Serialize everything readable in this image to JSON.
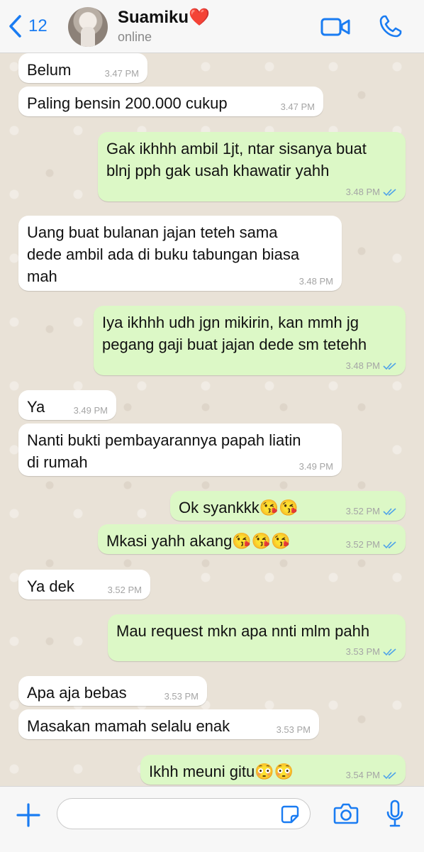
{
  "header": {
    "back_count": "12",
    "contact_name": "Suamiku❤️",
    "status": "online"
  },
  "messages": [
    {
      "dir": "in",
      "text": "Belum",
      "time": "3.47 PM"
    },
    {
      "dir": "in",
      "text": "Paling bensin 200.000 cukup",
      "time": "3.47 PM"
    },
    {
      "dir": "out",
      "text": "Gak ikhhh ambil 1jt, ntar sisanya buat\nblnj pph gak usah khawatir yahh",
      "time": "3.48 PM"
    },
    {
      "dir": "in",
      "text": "Uang buat bulanan jajan teteh sama\ndede ambil ada di buku tabungan biasa\nmah",
      "time": "3.48 PM"
    },
    {
      "dir": "out",
      "text": "Iya ikhhh udh jgn mikirin, kan mmh jg\npegang gaji buat jajan dede sm tetehh",
      "time": "3.48 PM"
    },
    {
      "dir": "in",
      "text": "Ya",
      "time": "3.49 PM"
    },
    {
      "dir": "in",
      "text": "Nanti bukti pembayarannya papah liatin\ndi rumah",
      "time": "3.49 PM"
    },
    {
      "dir": "out",
      "text": "Ok syankkk😘😘",
      "time": "3.52 PM"
    },
    {
      "dir": "out",
      "text": "Mkasi yahh akang😘😘😘",
      "time": "3.52 PM"
    },
    {
      "dir": "in",
      "text": "Ya dek",
      "time": "3.52 PM"
    },
    {
      "dir": "out",
      "text": "Mau request mkn apa nnti mlm pahh",
      "time": "3.53 PM"
    },
    {
      "dir": "in",
      "text": "Apa aja bebas",
      "time": "3.53 PM"
    },
    {
      "dir": "in",
      "text": "Masakan mamah selalu enak",
      "time": "3.53 PM"
    },
    {
      "dir": "out",
      "text": "Ikhh meuni gitu😳😳",
      "time": "3.54 PM"
    }
  ],
  "input": {
    "value": "",
    "placeholder": ""
  },
  "colors": {
    "accent": "#1a7cf2",
    "incoming": "#ffffff",
    "outgoing": "#dcf8c6",
    "read_tick": "#4fa3e8"
  },
  "icons": [
    "chevron-left-icon",
    "video-call-icon",
    "phone-icon",
    "plus-icon",
    "sticker-icon",
    "camera-icon",
    "microphone-icon",
    "double-check-icon"
  ]
}
